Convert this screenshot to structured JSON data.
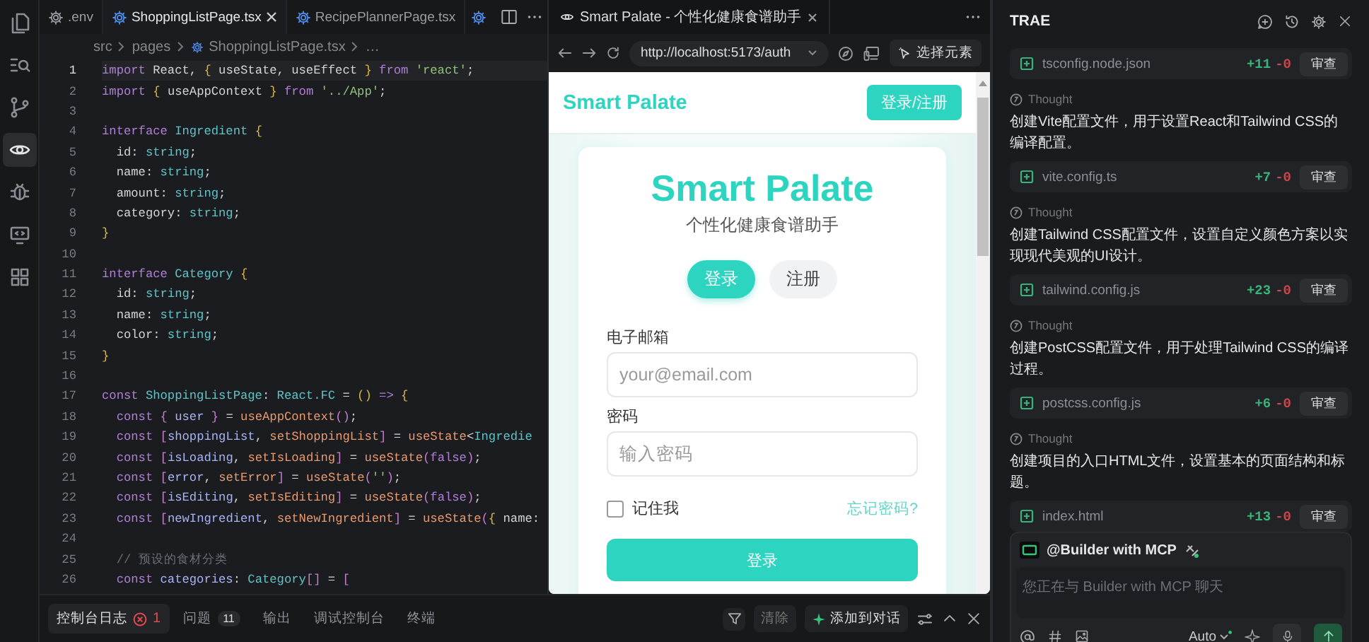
{
  "activity_bar": {
    "items": [
      {
        "kind": "files",
        "selected": false
      },
      {
        "kind": "search",
        "selected": false
      },
      {
        "kind": "branch",
        "selected": false
      },
      {
        "kind": "eye",
        "selected": true
      },
      {
        "kind": "bug",
        "selected": false
      },
      {
        "kind": "monitor",
        "selected": false
      },
      {
        "kind": "grid",
        "selected": false
      }
    ]
  },
  "editor": {
    "tabs": [
      {
        "label": ".env",
        "kind": "config",
        "selected": false
      },
      {
        "label": "ShoppingListPage.tsx",
        "kind": "react",
        "selected": true
      },
      {
        "label": "RecipePlannerPage.tsx",
        "kind": "react",
        "selected": false
      }
    ],
    "breadcrumb": [
      "src",
      "pages",
      "ShoppingListPage.tsx",
      "…"
    ],
    "lines": [
      {
        "number": "1",
        "active": true,
        "tokens": [
          {
            "kind": "kw",
            "text": "import"
          },
          {
            "kind": "id",
            "text": " React, "
          },
          {
            "kind": "br",
            "text": "{"
          },
          {
            "kind": "id",
            "text": " useState, useEffect "
          },
          {
            "kind": "br",
            "text": "}"
          },
          {
            "kind": "kw",
            "text": " from "
          },
          {
            "kind": "str",
            "text": "'react'"
          },
          {
            "kind": "id",
            "text": ";"
          }
        ]
      },
      {
        "number": "2",
        "active": false,
        "tokens": [
          {
            "kind": "kw",
            "text": "import "
          },
          {
            "kind": "br",
            "text": "{"
          },
          {
            "kind": "id",
            "text": " useAppContext "
          },
          {
            "kind": "br",
            "text": "}"
          },
          {
            "kind": "kw",
            "text": " from "
          },
          {
            "kind": "str",
            "text": "'../App'"
          },
          {
            "kind": "id",
            "text": ";"
          }
        ]
      },
      {
        "number": "3",
        "active": false
      },
      {
        "number": "4",
        "active": false,
        "tokens": [
          {
            "kind": "kw",
            "text": "interface "
          },
          {
            "kind": "type",
            "text": "Ingredient "
          },
          {
            "kind": "br",
            "text": "{"
          }
        ]
      },
      {
        "number": "5",
        "active": false,
        "tokens": [
          {
            "kind": "id",
            "text": "  id: "
          },
          {
            "kind": "type",
            "text": "string"
          },
          {
            "kind": "id",
            "text": ";"
          }
        ]
      },
      {
        "number": "6",
        "active": false,
        "tokens": [
          {
            "kind": "id",
            "text": "  name: "
          },
          {
            "kind": "type",
            "text": "string"
          },
          {
            "kind": "id",
            "text": ";"
          }
        ]
      },
      {
        "number": "7",
        "active": false,
        "tokens": [
          {
            "kind": "id",
            "text": "  amount: "
          },
          {
            "kind": "type",
            "text": "string"
          },
          {
            "kind": "id",
            "text": ";"
          }
        ]
      },
      {
        "number": "8",
        "active": false,
        "tokens": [
          {
            "kind": "id",
            "text": "  category: "
          },
          {
            "kind": "type",
            "text": "string"
          },
          {
            "kind": "id",
            "text": ";"
          }
        ]
      },
      {
        "number": "9",
        "active": false,
        "tokens": [
          {
            "kind": "br",
            "text": "}"
          }
        ]
      },
      {
        "number": "10",
        "active": false
      },
      {
        "number": "11",
        "active": false,
        "tokens": [
          {
            "kind": "kw",
            "text": "interface "
          },
          {
            "kind": "type",
            "text": "Category "
          },
          {
            "kind": "br",
            "text": "{"
          }
        ]
      },
      {
        "number": "12",
        "active": false,
        "tokens": [
          {
            "kind": "id",
            "text": "  id: "
          },
          {
            "kind": "type",
            "text": "string"
          },
          {
            "kind": "id",
            "text": ";"
          }
        ]
      },
      {
        "number": "13",
        "active": false,
        "tokens": [
          {
            "kind": "id",
            "text": "  name: "
          },
          {
            "kind": "type",
            "text": "string"
          },
          {
            "kind": "id",
            "text": ";"
          }
        ]
      },
      {
        "number": "14",
        "active": false,
        "tokens": [
          {
            "kind": "id",
            "text": "  color: "
          },
          {
            "kind": "type",
            "text": "string"
          },
          {
            "kind": "id",
            "text": ";"
          }
        ]
      },
      {
        "number": "15",
        "active": false,
        "tokens": [
          {
            "kind": "br",
            "text": "}"
          }
        ]
      },
      {
        "number": "16",
        "active": false
      },
      {
        "number": "17",
        "active": false,
        "tokens": [
          {
            "kind": "kw",
            "text": "const "
          },
          {
            "kind": "type",
            "text": "ShoppingListPage"
          },
          {
            "kind": "id",
            "text": ": "
          },
          {
            "kind": "type",
            "text": "React.FC"
          },
          {
            "kind": "id",
            "text": " = "
          },
          {
            "kind": "br",
            "text": "()"
          },
          {
            "kind": "kw",
            "text": " => "
          },
          {
            "kind": "br",
            "text": "{"
          }
        ]
      },
      {
        "number": "18",
        "active": false,
        "tokens": [
          {
            "kind": "kw",
            "text": "  const "
          },
          {
            "kind": "br2",
            "text": "{"
          },
          {
            "kind": "var",
            "text": " user "
          },
          {
            "kind": "br2",
            "text": "}"
          },
          {
            "kind": "id",
            "text": " = "
          },
          {
            "kind": "fn",
            "text": "useAppContext"
          },
          {
            "kind": "br2",
            "text": "()"
          },
          {
            "kind": "id",
            "text": ";"
          }
        ]
      },
      {
        "number": "19",
        "active": false,
        "tokens": [
          {
            "kind": "kw",
            "text": "  const "
          },
          {
            "kind": "br2",
            "text": "["
          },
          {
            "kind": "var",
            "text": "shoppingList"
          },
          {
            "kind": "id",
            "text": ", "
          },
          {
            "kind": "fn",
            "text": "setShoppingList"
          },
          {
            "kind": "br2",
            "text": "]"
          },
          {
            "kind": "id",
            "text": " = "
          },
          {
            "kind": "fn",
            "text": "useState"
          },
          {
            "kind": "id",
            "text": "<"
          },
          {
            "kind": "type",
            "text": "Ingredie"
          }
        ]
      },
      {
        "number": "20",
        "active": false,
        "tokens": [
          {
            "kind": "kw",
            "text": "  const "
          },
          {
            "kind": "br2",
            "text": "["
          },
          {
            "kind": "var",
            "text": "isLoading"
          },
          {
            "kind": "id",
            "text": ", "
          },
          {
            "kind": "fn",
            "text": "setIsLoading"
          },
          {
            "kind": "br2",
            "text": "]"
          },
          {
            "kind": "id",
            "text": " = "
          },
          {
            "kind": "fn",
            "text": "useState"
          },
          {
            "kind": "br2",
            "text": "("
          },
          {
            "kind": "kw",
            "text": "false"
          },
          {
            "kind": "br2",
            "text": ")"
          },
          {
            "kind": "id",
            "text": ";"
          }
        ]
      },
      {
        "number": "21",
        "active": false,
        "tokens": [
          {
            "kind": "kw",
            "text": "  const "
          },
          {
            "kind": "br2",
            "text": "["
          },
          {
            "kind": "var",
            "text": "error"
          },
          {
            "kind": "id",
            "text": ", "
          },
          {
            "kind": "fn",
            "text": "setError"
          },
          {
            "kind": "br2",
            "text": "]"
          },
          {
            "kind": "id",
            "text": " = "
          },
          {
            "kind": "fn",
            "text": "useState"
          },
          {
            "kind": "br2",
            "text": "("
          },
          {
            "kind": "str",
            "text": "''"
          },
          {
            "kind": "br2",
            "text": ")"
          },
          {
            "kind": "id",
            "text": ";"
          }
        ]
      },
      {
        "number": "22",
        "active": false,
        "tokens": [
          {
            "kind": "kw",
            "text": "  const "
          },
          {
            "kind": "br2",
            "text": "["
          },
          {
            "kind": "var",
            "text": "isEditing"
          },
          {
            "kind": "id",
            "text": ", "
          },
          {
            "kind": "fn",
            "text": "setIsEditing"
          },
          {
            "kind": "br2",
            "text": "]"
          },
          {
            "kind": "id",
            "text": " = "
          },
          {
            "kind": "fn",
            "text": "useState"
          },
          {
            "kind": "br2",
            "text": "("
          },
          {
            "kind": "kw",
            "text": "false"
          },
          {
            "kind": "br2",
            "text": ")"
          },
          {
            "kind": "id",
            "text": ";"
          }
        ]
      },
      {
        "number": "23",
        "active": false,
        "tokens": [
          {
            "kind": "kw",
            "text": "  const "
          },
          {
            "kind": "br2",
            "text": "["
          },
          {
            "kind": "var",
            "text": "newIngredient"
          },
          {
            "kind": "id",
            "text": ", "
          },
          {
            "kind": "fn",
            "text": "setNewIngredient"
          },
          {
            "kind": "br2",
            "text": "]"
          },
          {
            "kind": "id",
            "text": " = "
          },
          {
            "kind": "fn",
            "text": "useState"
          },
          {
            "kind": "br2",
            "text": "("
          },
          {
            "kind": "br",
            "text": "{"
          },
          {
            "kind": "id",
            "text": " name:"
          }
        ]
      },
      {
        "number": "24",
        "active": false
      },
      {
        "number": "25",
        "active": false,
        "tokens": [
          {
            "kind": "cm",
            "text": "  // 预设的食材分类"
          }
        ]
      },
      {
        "number": "26",
        "active": false,
        "tokens": [
          {
            "kind": "kw",
            "text": "  const "
          },
          {
            "kind": "var",
            "text": "categories"
          },
          {
            "kind": "id",
            "text": ": "
          },
          {
            "kind": "type",
            "text": "Category"
          },
          {
            "kind": "br2",
            "text": "[]"
          },
          {
            "kind": "id",
            "text": " = "
          },
          {
            "kind": "br2",
            "text": "["
          }
        ]
      }
    ]
  },
  "browser": {
    "tab": {
      "title": "Smart Palate - 个性化健康食谱助手"
    },
    "url": "http://localhost:5173/auth",
    "select_element": "选择元素",
    "page": {
      "brand": "Smart Palate",
      "header_button": "登录/注册",
      "card": {
        "title": "Smart Palate",
        "subtitle": "个性化健康食谱助手",
        "mode_tabs": [
          {
            "label": "登录",
            "selected": true
          },
          {
            "label": "注册",
            "selected": false
          }
        ],
        "fields": [
          {
            "label": "电子邮箱",
            "placeholder": "your@email.com"
          },
          {
            "label": "密码",
            "placeholder": "输入密码"
          }
        ],
        "remember": {
          "label": "记住我",
          "checked": false
        },
        "forgot_link": "忘记密码?",
        "submit": "登录"
      }
    }
  },
  "bottom_panel": {
    "tabs": [
      {
        "label": "控制台日志",
        "selected": true,
        "error_count": "1"
      },
      {
        "label": "问题",
        "selected": false,
        "badge": "11"
      },
      {
        "label": "输出",
        "selected": false
      },
      {
        "label": "调试控制台",
        "selected": false
      },
      {
        "label": "终端",
        "selected": false
      }
    ],
    "clear_button": "清除",
    "add_button": "添加到对话"
  },
  "assistant": {
    "title": "TRAE",
    "items": [
      {
        "kind": "file",
        "name": "tsconfig.node.json",
        "added": "+11",
        "removed": "-0",
        "action": "审查"
      },
      {
        "kind": "thought",
        "label": "Thought",
        "text": "创建Vite配置文件，用于设置React和Tailwind CSS的编译配置。"
      },
      {
        "kind": "file",
        "name": "vite.config.ts",
        "added": "+7",
        "removed": "-0",
        "action": "审查"
      },
      {
        "kind": "thought",
        "label": "Thought",
        "text": "创建Tailwind CSS配置文件，设置自定义颜色方案以实现现代美观的UI设计。"
      },
      {
        "kind": "file",
        "name": "tailwind.config.js",
        "added": "+23",
        "removed": "-0",
        "action": "审查"
      },
      {
        "kind": "thought",
        "label": "Thought",
        "text": "创建PostCSS配置文件，用于处理Tailwind CSS的编译过程。"
      },
      {
        "kind": "file",
        "name": "postcss.config.js",
        "added": "+6",
        "removed": "-0",
        "action": "审查"
      },
      {
        "kind": "thought",
        "label": "Thought",
        "text": "创建项目的入口HTML文件，设置基本的页面结构和标题。"
      },
      {
        "kind": "file",
        "name": "index.html",
        "added": "+13",
        "removed": "-0",
        "action": "审查"
      }
    ],
    "composer": {
      "agent": "@Builder with MCP",
      "placeholder": "您正在与 Builder with MCP 聊天",
      "mode": "Auto"
    }
  }
}
